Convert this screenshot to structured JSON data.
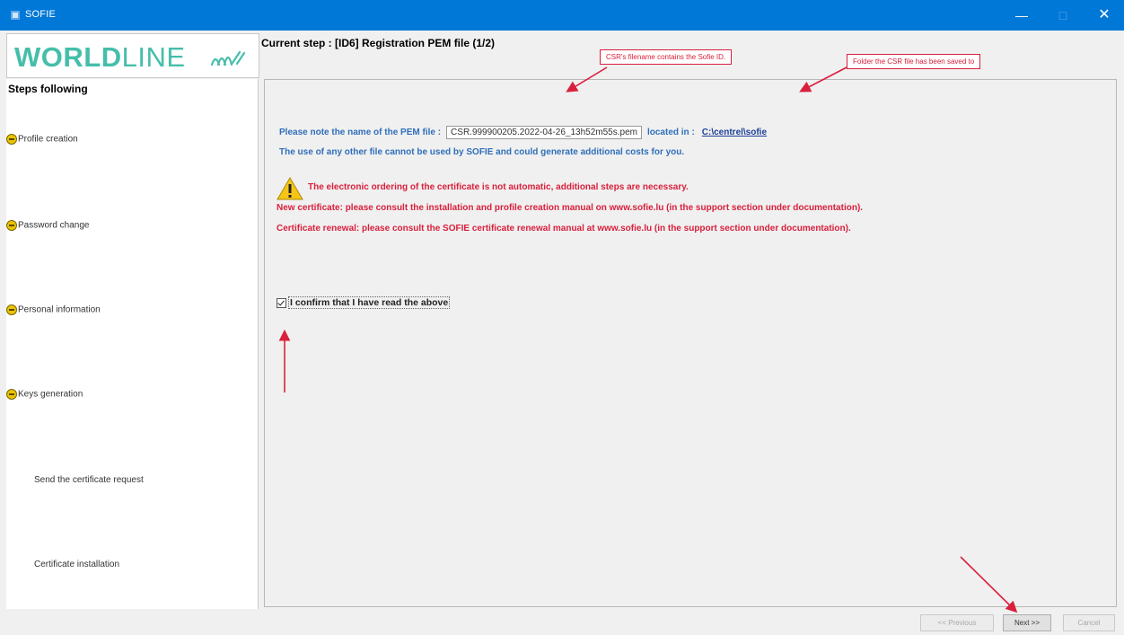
{
  "window": {
    "title": "SOFIE",
    "minimize": "—",
    "maximize": "□",
    "close": "✕"
  },
  "logo": {
    "bold_part": "WORLD",
    "thin_part": "LINE",
    "brand_color": "#46beaa"
  },
  "header": {
    "current_step": "Current step :  [ID6]  Registration PEM file (1/2)"
  },
  "sidebar": {
    "title": "Steps following",
    "steps": [
      {
        "label": "Profile creation",
        "done": true
      },
      {
        "label": "Password change",
        "done": true
      },
      {
        "label": "Personal information",
        "done": true
      },
      {
        "label": "Keys generation",
        "done": true
      },
      {
        "label": "Send the certificate request",
        "done": false
      },
      {
        "label": "Certificate installation",
        "done": false
      }
    ]
  },
  "main": {
    "pem_prefix": "Please note the name of the PEM file :",
    "pem_filename": "CSR.999900205.2022-04-26_13h52m55s.pem",
    "located_in": "located in :",
    "folder": "C:\\centrel\\sofie",
    "use_notice": "The use of any other file cannot be used by SOFIE and could generate additional costs for you.",
    "warning_main": "The electronic ordering of the certificate is not automatic, additional steps are necessary.",
    "warning_new": "New certificate: please consult the installation and profile creation manual on www.sofie.lu (in the support section under documentation).",
    "warning_renewal": "Certificate renewal: please consult the SOFIE certificate renewal manual at www.sofie.lu (in the support section under documentation).",
    "confirm_label": "I confirm that I have read the above",
    "confirm_checked": true
  },
  "annotations": {
    "callout_filename": "CSR's filename contains the Sofie ID.",
    "callout_folder": "Folder the CSR file has been saved to",
    "color": "#d9203c"
  },
  "buttons": {
    "previous": "<< Previous",
    "next": "Next >>",
    "cancel": "Cancel"
  },
  "colors": {
    "titlebar": "#0078d7",
    "info_text": "#2f6fba",
    "warning_text": "#d9203c"
  }
}
